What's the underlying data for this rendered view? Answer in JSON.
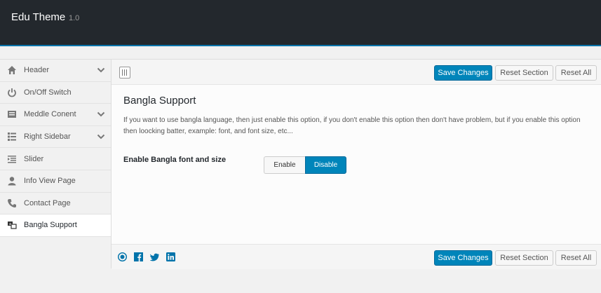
{
  "header": {
    "title": "Edu Theme",
    "version": "1.0"
  },
  "sidebar": {
    "items": [
      {
        "label": "Header",
        "icon": "home-icon",
        "has_children": true
      },
      {
        "label": "On/Off Switch",
        "icon": "power-icon",
        "has_children": false
      },
      {
        "label": "Meddle Conent",
        "icon": "content-icon",
        "has_children": true
      },
      {
        "label": "Right Sidebar",
        "icon": "list-icon",
        "has_children": true
      },
      {
        "label": "Slider",
        "icon": "slider-icon",
        "has_children": false
      },
      {
        "label": "Info View Page",
        "icon": "user-icon",
        "has_children": false
      },
      {
        "label": "Contact Page",
        "icon": "phone-icon",
        "has_children": false
      },
      {
        "label": "Bangla Support",
        "icon": "translate-icon",
        "has_children": false,
        "active": true
      }
    ]
  },
  "toolbar": {
    "save_label": "Save Changes",
    "reset_section_label": "Reset Section",
    "reset_all_label": "Reset All"
  },
  "section": {
    "title": "Bangla Support",
    "description": "If you want to use bangla language, then just enable this option, if you don't enable this option then don't have problem, but if you enable this option then loocking batter, example: font, and font size, etc...",
    "field_label": "Enable Bangla font and size",
    "enable_label": "Enable",
    "disable_label": "Disable",
    "selected": "Disable"
  },
  "footer": {
    "social": [
      "wordpress-icon",
      "facebook-icon",
      "twitter-icon",
      "linkedin-icon"
    ]
  },
  "colors": {
    "accent": "#0085ba",
    "header_bg": "#23282d",
    "header_border": "#0073aa"
  }
}
